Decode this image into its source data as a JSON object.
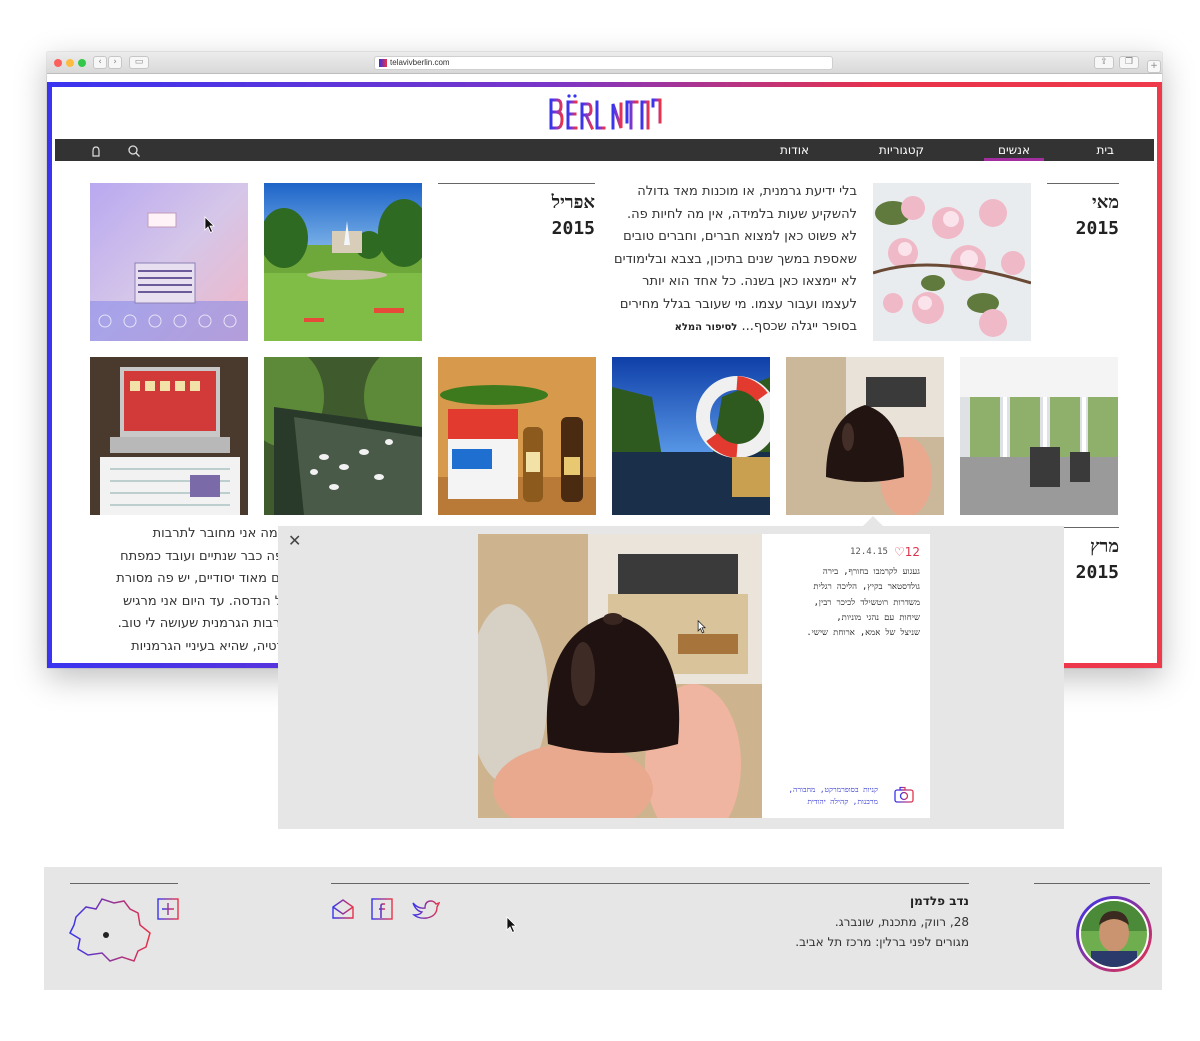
{
  "browser": {
    "url": "telavivberlin.com"
  },
  "site": {
    "logo_text": "BËRLIN",
    "logo_hebrew": "תֵּלאָבִיב"
  },
  "nav": {
    "items": [
      {
        "label": "בית",
        "active": false
      },
      {
        "label": "אנשים",
        "active": true
      },
      {
        "label": "קטגוריות",
        "active": false
      },
      {
        "label": "אודות",
        "active": false
      }
    ]
  },
  "months": [
    {
      "name": "מאי",
      "year": "2015"
    },
    {
      "name": "אפריל",
      "year": "2015"
    },
    {
      "name": "מרץ",
      "year": "2015"
    }
  ],
  "may_story": {
    "lines": [
      "בלי ידיעת גרמנית, או מוכנות מאד גדולה",
      "להשקיע שעות בלמידה, אין מה לחיות פה.",
      "לא פשוט כאן למצוא חברים, וחברים טובים",
      "שאספת במשך שנים בתיכון, בצבא ובלימודים",
      "לא יימצאו כאן בשנה. כל אחד הוא יותר",
      "לעצמו ועבור עצמו. מי שעובר בגלל מחירים",
      "בסופר ייגלה שכסף..."
    ],
    "more_label": "לסיפור המלא"
  },
  "march_story": {
    "lines": [
      "עד כמה אני מחובר לתרבות",
      "אני פה כבר שנתיים ועובד כמפתח",
      "רמנים מאוד יסודיים, יש פה מסורת",
      "ח של הנדסה. עד היום אני מרגיש",
      "ו בתרבות הגרמנית שעושה לי טוב.",
      "רוקרטיה, שהיא בעיניי הגרמניות"
    ]
  },
  "popup": {
    "likes": "12",
    "date": "12.4.15",
    "text_lines": [
      "געגוע לקרמבו בחורף, בירה",
      "גולדסטאר בקיץ, הליכה רגלית",
      "משדרות רוטשילד לכיכר רבין,",
      "שיחות עם נהגי מוניות,",
      "שניצל של אמא, ארוחת שישי."
    ],
    "tags_lines": [
      "קניות בסופרמרקט, מחבורה,",
      "מרבנות, קהילה יהודית"
    ],
    "close_label": "✕"
  },
  "footer": {
    "name": "נדב פלדמן",
    "line1": "28, רווק, מתכנת, שונברג.",
    "line2": "מגורים לפני ברלין: מרכז תל אביב."
  },
  "colors": {
    "blue": "#3a34f0",
    "purple": "#8a36c4",
    "red": "#ea3248",
    "nav_bg": "#333333",
    "active_underline": "#a32ea0",
    "popup_bg": "#e6e6e6",
    "footer_bg": "#e6e6e6"
  },
  "icons": [
    "search-icon",
    "user-icon",
    "close-icon",
    "heart-icon",
    "camera-icon",
    "mail-icon",
    "facebook-icon",
    "twitter-icon",
    "plus-icon",
    "berlin-map-icon"
  ]
}
